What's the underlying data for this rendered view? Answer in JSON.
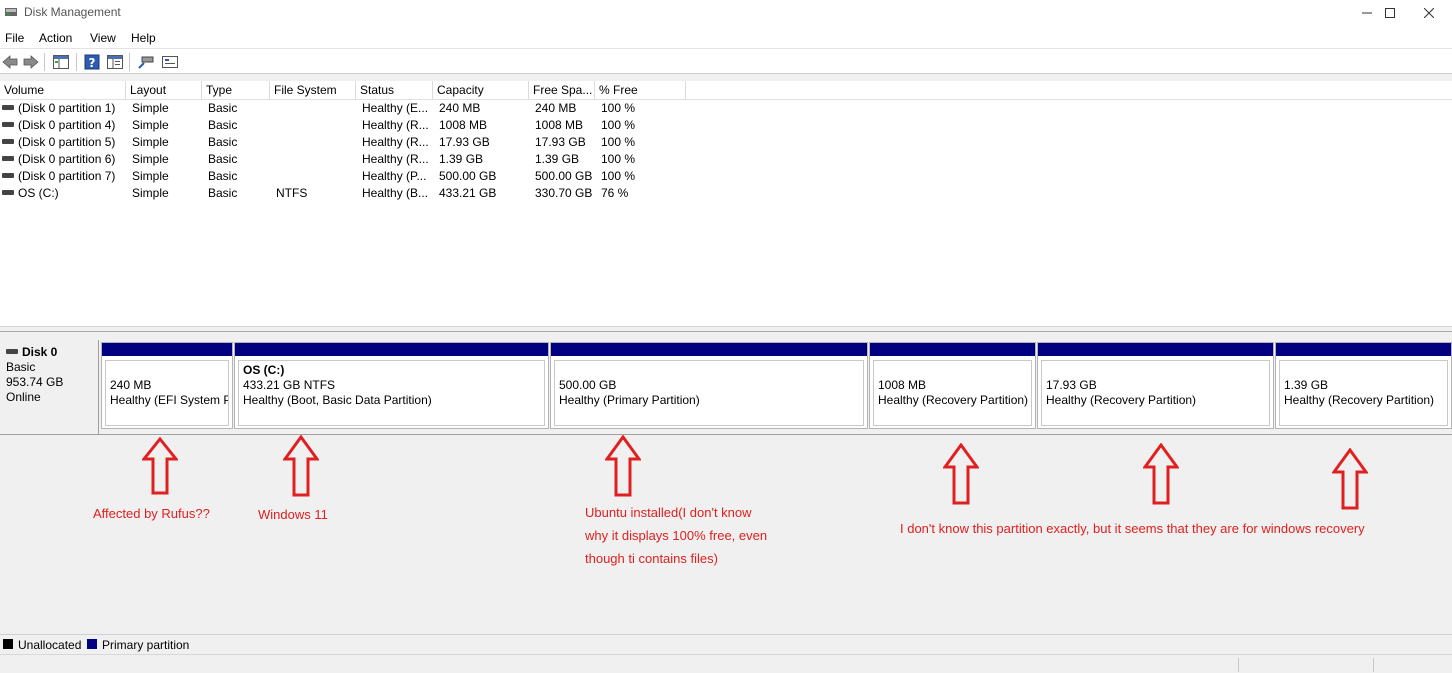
{
  "window": {
    "title": "Disk Management",
    "icon": "disk-management-icon"
  },
  "window_buttons": [
    "minimize-icon",
    "maximize-icon",
    "close-icon"
  ],
  "menu": [
    "File",
    "Action",
    "View",
    "Help"
  ],
  "toolbar": [
    "back-icon",
    "forward-icon",
    "console-tree-icon",
    "help-icon",
    "properties-icon",
    "connect-icon",
    "settings-icon"
  ],
  "volume_list": {
    "columns": [
      "Volume",
      "Layout",
      "Type",
      "File System",
      "Status",
      "Capacity",
      "Free Spa...",
      "% Free"
    ],
    "rows": [
      [
        "(Disk 0 partition 1)",
        "Simple",
        "Basic",
        "",
        "Healthy (E...",
        "240 MB",
        "240 MB",
        "100 %"
      ],
      [
        "(Disk 0 partition 4)",
        "Simple",
        "Basic",
        "",
        "Healthy (R...",
        "1008 MB",
        "1008 MB",
        "100 %"
      ],
      [
        "(Disk 0 partition 5)",
        "Simple",
        "Basic",
        "",
        "Healthy (R...",
        "17.93 GB",
        "17.93 GB",
        "100 %"
      ],
      [
        "(Disk 0 partition 6)",
        "Simple",
        "Basic",
        "",
        "Healthy (R...",
        "1.39 GB",
        "1.39 GB",
        "100 %"
      ],
      [
        "(Disk 0 partition 7)",
        "Simple",
        "Basic",
        "",
        "Healthy (P...",
        "500.00 GB",
        "500.00 GB",
        "100 %"
      ],
      [
        "OS (C:)",
        "Simple",
        "Basic",
        "NTFS",
        "Healthy (B...",
        "433.21 GB",
        "330.70 GB",
        "76 %"
      ]
    ]
  },
  "disk": {
    "name": "Disk 0",
    "type": "Basic",
    "size": "953.74 GB",
    "status": "Online",
    "partitions": [
      {
        "title": "",
        "size": "240 MB",
        "status": "Healthy (EFI System Pa"
      },
      {
        "title": "OS  (C:)",
        "size": "433.21 GB NTFS",
        "status": "Healthy (Boot, Basic Data Partition)"
      },
      {
        "title": "",
        "size": "500.00 GB",
        "status": "Healthy (Primary Partition)"
      },
      {
        "title": "",
        "size": "1008 MB",
        "status": "Healthy (Recovery Partition)"
      },
      {
        "title": "",
        "size": "17.93 GB",
        "status": "Healthy (Recovery Partition)"
      },
      {
        "title": "",
        "size": "1.39 GB",
        "status": "Healthy (Recovery Partition)"
      }
    ]
  },
  "annotations": {
    "efi": "Affected by Rufus??",
    "os": "Windows 11",
    "ubuntu": [
      "Ubuntu installed(I don't know",
      "why it displays 100% free, even",
      "though ti contains files)"
    ],
    "recovery": "I don't know this partition exactly, but it seems that they are for windows recovery"
  },
  "legend": {
    "unallocated": "Unallocated",
    "primary": "Primary partition"
  },
  "colors": {
    "primary_partition": "#000080",
    "unallocated": "#000000",
    "annotation": "#e02020"
  }
}
